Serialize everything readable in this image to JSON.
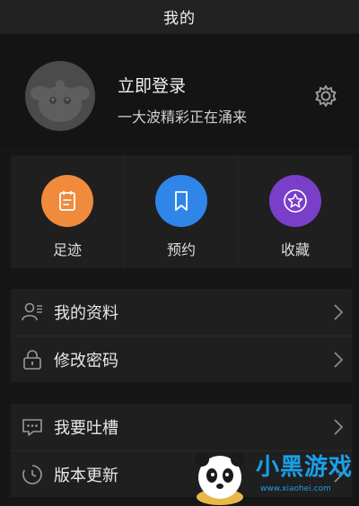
{
  "header": {
    "title": "我的"
  },
  "profile": {
    "login_label": "立即登录",
    "subtitle": "一大波精彩正在涌来"
  },
  "quick_actions": [
    {
      "label": "足迹",
      "icon": "notepad-icon",
      "color": "#f08a3c"
    },
    {
      "label": "预约",
      "icon": "bookmark-icon",
      "color": "#2f86e8"
    },
    {
      "label": "收藏",
      "icon": "star-icon",
      "color": "#7a3fc9"
    }
  ],
  "menu_group1": [
    {
      "label": "我的资料",
      "icon": "user-profile-icon"
    },
    {
      "label": "修改密码",
      "icon": "lock-icon"
    }
  ],
  "menu_group2": [
    {
      "label": "我要吐槽",
      "icon": "chat-icon"
    },
    {
      "label": "版本更新",
      "icon": "clock-icon"
    }
  ],
  "watermark": {
    "text": "小黑游戏",
    "url": "www.xiaohei.com"
  }
}
